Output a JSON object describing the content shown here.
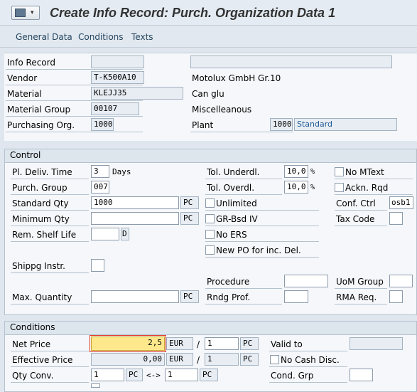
{
  "header": {
    "title": "Create Info Record: Purch. Organization Data 1"
  },
  "toolbar": {
    "items": [
      "General Data",
      "Conditions",
      "Texts"
    ]
  },
  "head": {
    "info_record_label": "Info Record",
    "info_record_value": "",
    "info_record_desc": "",
    "vendor_label": "Vendor",
    "vendor_value": "T-K500A10",
    "vendor_desc": "Motolux GmbH Gr.10",
    "material_label": "Material",
    "material_value": "KLEJJ35",
    "material_desc": "Can glu",
    "material_group_label": "Material Group",
    "material_group_value": "00107",
    "material_group_desc": "Miscelleanous",
    "purch_org_label": "Purchasing Org.",
    "purch_org_value": "1000",
    "plant_label": "Plant",
    "plant_value": "1000",
    "plant_desc": "Standard"
  },
  "control": {
    "title": "Control",
    "pl_deliv_time_label": "Pl. Deliv. Time",
    "pl_deliv_time_value": "3",
    "pl_deliv_time_unit": "Days",
    "purch_group_label": "Purch. Group",
    "purch_group_value": "007",
    "standard_qty_label": "Standard Qty",
    "standard_qty_value": "1000",
    "standard_qty_unit": "PC",
    "minimum_qty_label": "Minimum Qty",
    "minimum_qty_value": "",
    "minimum_qty_unit": "PC",
    "rem_shelf_life_label": "Rem. Shelf Life",
    "rem_shelf_life_value": "",
    "rem_shelf_life_unit": "D",
    "shippg_instr_label": "Shippg Instr.",
    "shippg_instr_value": "",
    "max_quantity_label": "Max. Quantity",
    "max_quantity_value": "",
    "max_quantity_unit": "PC",
    "tol_underdl_label": "Tol. Underdl.",
    "tol_underdl_value": "10,0",
    "tol_underdl_unit": "%",
    "tol_overdl_label": "Tol. Overdl.",
    "tol_overdl_value": "10,0",
    "tol_overdl_unit": "%",
    "unlimited_label": "Unlimited",
    "unlimited_checked": false,
    "gr_bsd_iv_label": "GR-Bsd IV",
    "gr_bsd_iv_checked": false,
    "no_ers_label": "No ERS",
    "no_ers_checked": false,
    "new_po_label": "New PO for inc. Del.",
    "new_po_checked": false,
    "procedure_label": "Procedure",
    "procedure_value": "",
    "rndg_prof_label": "Rndg Prof.",
    "rndg_prof_value": "",
    "no_mtext_label": "No MText",
    "no_mtext_checked": false,
    "ackn_rqd_label": "Ackn. Rqd",
    "ackn_rqd_checked": false,
    "conf_ctrl_label": "Conf. Ctrl",
    "conf_ctrl_value": "osb1",
    "tax_code_label": "Tax Code",
    "tax_code_value": "",
    "uom_group_label": "UoM Group",
    "uom_group_value": "",
    "rma_req_label": "RMA Req.",
    "rma_req_value": ""
  },
  "conditions": {
    "title": "Conditions",
    "net_price_label": "Net Price",
    "net_price_value": "2,5",
    "net_price_currency": "EUR",
    "net_price_per": "1",
    "net_price_unit": "PC",
    "effective_price_label": "Effective Price",
    "effective_price_value": "0,00",
    "effective_price_currency": "EUR",
    "effective_price_per": "1",
    "effective_price_unit": "PC",
    "slash": "/",
    "qty_conv_label": "Qty Conv.",
    "qty_conv_left": "1",
    "qty_conv_left_unit": "PC",
    "qty_conv_arrow": "<->",
    "qty_conv_right": "1",
    "qty_conv_right_unit": "PC",
    "valid_to_label": "Valid to",
    "valid_to_value": "",
    "no_cash_disc_label": "No Cash Disc.",
    "no_cash_disc_checked": false,
    "cond_grp_label": "Cond. Grp",
    "cond_grp_value": ""
  }
}
